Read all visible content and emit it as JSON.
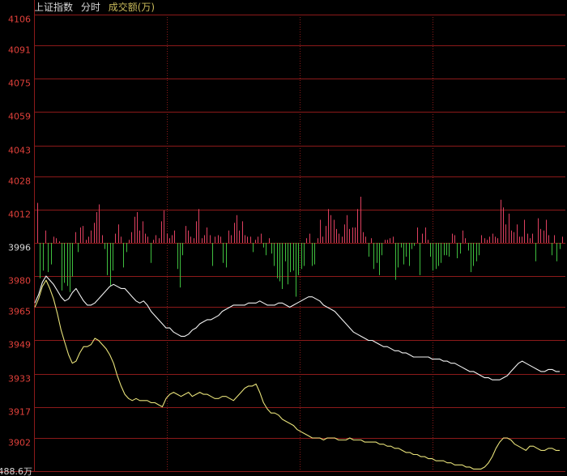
{
  "header": {
    "title": "上证指数",
    "mode": "分时",
    "metric": "成交额(万)"
  },
  "colors": {
    "background": "#000000",
    "grid": "#8c1a1a",
    "axis_label": "#e0403a",
    "base_label": "#d8d8d8",
    "white_line": "#f2f2f2",
    "yellow_line": "#e8e27a",
    "volume_up": "#e04060",
    "volume_down": "#3fbf3f"
  },
  "chart_data": {
    "type": "line",
    "ylim": [
      3886,
      4106
    ],
    "baseline": 3996,
    "yticks": [
      "4106",
      "4091",
      "4075",
      "4059",
      "4043",
      "4028",
      "4012",
      "3996",
      "3980",
      "3965",
      "3949",
      "3933",
      "3917",
      "3902"
    ],
    "volume_axis_label": "488.6万",
    "series": [
      {
        "color": "white",
        "values": [
          3967,
          3971,
          3977,
          3980,
          3978,
          3976,
          3973,
          3970,
          3968,
          3969,
          3972,
          3974,
          3971,
          3968,
          3966,
          3966,
          3967,
          3969,
          3971,
          3973,
          3975,
          3976,
          3975,
          3974,
          3974,
          3972,
          3970,
          3968,
          3967,
          3968,
          3966,
          3963,
          3961,
          3959,
          3957,
          3955,
          3955,
          3953,
          3952,
          3951,
          3951,
          3952,
          3954,
          3955,
          3957,
          3958,
          3959,
          3959,
          3960,
          3961,
          3963,
          3964,
          3965,
          3966,
          3966,
          3966,
          3966,
          3967,
          3967,
          3967,
          3968,
          3967,
          3966,
          3966,
          3966,
          3967,
          3967,
          3966,
          3965,
          3966,
          3967,
          3968,
          3969,
          3970,
          3970,
          3969,
          3968,
          3966,
          3965,
          3964,
          3963,
          3961,
          3959,
          3957,
          3955,
          3953,
          3952,
          3951,
          3950,
          3949,
          3949,
          3948,
          3947,
          3946,
          3946,
          3945,
          3944,
          3944,
          3943,
          3943,
          3942,
          3941,
          3941,
          3941,
          3941,
          3941,
          3940,
          3940,
          3940,
          3939,
          3939,
          3938,
          3938,
          3937,
          3936,
          3935,
          3934,
          3934,
          3933,
          3932,
          3931,
          3931,
          3930,
          3930,
          3930,
          3931,
          3932,
          3934,
          3936,
          3938,
          3939,
          3938,
          3937,
          3936,
          3935,
          3934,
          3934,
          3935,
          3935,
          3934,
          3934
        ]
      },
      {
        "color": "yellow",
        "values": [
          3965,
          3969,
          3975,
          3978,
          3974,
          3969,
          3962,
          3954,
          3948,
          3942,
          3938,
          3939,
          3943,
          3946,
          3946,
          3947,
          3950,
          3949,
          3947,
          3945,
          3942,
          3938,
          3932,
          3927,
          3923,
          3921,
          3920,
          3921,
          3920,
          3920,
          3920,
          3919,
          3919,
          3918,
          3917,
          3921,
          3923,
          3924,
          3923,
          3922,
          3923,
          3924,
          3922,
          3923,
          3924,
          3923,
          3923,
          3922,
          3921,
          3921,
          3922,
          3922,
          3921,
          3920,
          3922,
          3924,
          3926,
          3927,
          3927,
          3928,
          3924,
          3919,
          3916,
          3914,
          3914,
          3913,
          3911,
          3910,
          3909,
          3908,
          3906,
          3905,
          3904,
          3903,
          3902,
          3902,
          3902,
          3901,
          3902,
          3902,
          3902,
          3901,
          3901,
          3901,
          3902,
          3901,
          3901,
          3901,
          3900,
          3900,
          3900,
          3900,
          3899,
          3899,
          3898,
          3898,
          3897,
          3897,
          3896,
          3895,
          3895,
          3894,
          3894,
          3893,
          3893,
          3892,
          3892,
          3891,
          3891,
          3891,
          3890,
          3890,
          3889,
          3889,
          3889,
          3888,
          3888,
          3887,
          3887,
          3887,
          3888,
          3890,
          3893,
          3897,
          3900,
          3902,
          3902,
          3901,
          3899,
          3898,
          3897,
          3896,
          3898,
          3898,
          3897,
          3896,
          3896,
          3897,
          3897,
          3896,
          3896
        ]
      }
    ],
    "volume": [
      2.6,
      -2.3,
      -1.8,
      0.8,
      -1.9,
      -1.4,
      0.4,
      0.3,
      0.1,
      -3.1,
      -2.6,
      -2.8,
      -3.2,
      -2.2,
      0.7,
      -0.6,
      1.0,
      1.1,
      0.2,
      0.4,
      0.8,
      1.3,
      2.0,
      2.5,
      0.5,
      -0.4,
      -2.1,
      -2.8,
      -1.8,
      0.6,
      1.2,
      0.4,
      -1.6,
      -0.6,
      0.2,
      0.7,
      1.7,
      2.0,
      0.8,
      1.4,
      0.6,
      0.4,
      -1.3,
      0.2,
      0.5,
      0.3,
      1.4,
      2.1,
      0.6,
      0.3,
      0.5,
      0.8,
      -1.7,
      -2.9,
      -0.8,
      1.1,
      0.8,
      0.4,
      0.3,
      1.4,
      2.2,
      0.3,
      0.5,
      1.0,
      0.5,
      -1.5,
      0.4,
      0.5,
      0.4,
      -1.3,
      -1.6,
      0.8,
      0.5,
      1.3,
      1.8,
      0.8,
      1.4,
      0.5,
      0.4,
      0.4,
      -0.6,
      0.2,
      0.4,
      0.6,
      -0.3,
      -0.8,
      0.3,
      -0.7,
      -1.5,
      -2.3,
      -2.5,
      -3.0,
      -1.2,
      -2.7,
      -1.9,
      -1.8,
      -3.5,
      -2.1,
      -1.7,
      -1.5,
      0.3,
      0.6,
      -1.5,
      -1.4,
      0.3,
      1.5,
      0.4,
      1.1,
      2.2,
      1.8,
      1.5,
      0.9,
      0.6,
      0.4,
      1.2,
      1.8,
      0.9,
      1.0,
      1.0,
      2.2,
      3.0,
      0.7,
      0.4,
      -0.9,
      0.3,
      -1.7,
      -1.3,
      -2.1,
      -0.8,
      0.2,
      0.2,
      0.3,
      0.4,
      -2.4,
      -1.6,
      -0.3,
      -1.4,
      -0.9,
      -1.5,
      -0.4,
      -0.2,
      1.0,
      -2.1,
      0.6,
      1.0,
      0.2,
      -0.9,
      -1.8,
      -1.7,
      -1.5,
      -1.3,
      -0.8,
      -0.8,
      -0.9,
      0.6,
      0.5,
      -1.0,
      -0.7,
      0.8,
      0.3,
      -0.5,
      -1.9,
      -1.5,
      -1.2,
      -0.8,
      0.5,
      0.3,
      0.2,
      0.4,
      0.6,
      0.4,
      0.3,
      2.8,
      2.3,
      1.2,
      1.9,
      0.8,
      0.7,
      1.2,
      0.4,
      0.4,
      1.5,
      0.6,
      0.3,
      0.6,
      -1.2,
      1.6,
      0.9,
      0.8,
      1.5,
      0.5,
      -0.8,
      0.5,
      -1.2,
      -0.4,
      0.4
    ]
  }
}
